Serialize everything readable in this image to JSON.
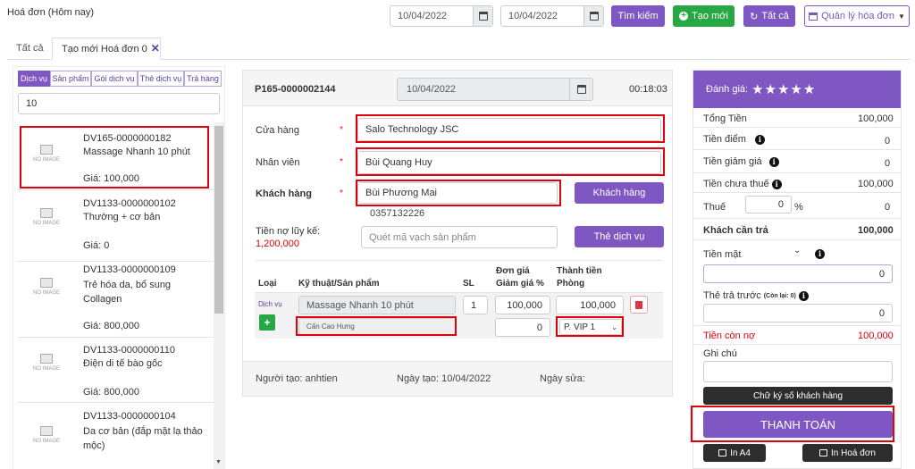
{
  "header": {
    "title": "Hoá đơn (Hôm nay)",
    "date_from": "10/04/2022",
    "date_to": "10/04/2022",
    "search_label": "Tìm kiếm",
    "new_label": "Tạo mới",
    "all_label": "Tất cả",
    "manage_label": "Quản lý hóa đơn"
  },
  "tabs": [
    {
      "label": "Tất cả"
    },
    {
      "label": "Tạo mới Hoá đơn 0"
    }
  ],
  "left": {
    "filters": [
      "Dịch vụ",
      "Sản phẩm",
      "Gói dịch vụ",
      "Thẻ dịch vụ",
      "Trả hàng"
    ],
    "search_value": "10",
    "noimage_label": "NO IMAGE",
    "items": [
      {
        "code": "DV165-0000000182",
        "name": "Massage Nhanh 10 phút",
        "price": "Giá: 100,000"
      },
      {
        "code": "DV1133-0000000102",
        "name": "Thường + cơ bản",
        "price": "Giá: 0"
      },
      {
        "code": "DV1133-0000000109",
        "name": "Trẻ hóa da, bổ sung Collagen",
        "price": "Giá: 800,000"
      },
      {
        "code": "DV1133-0000000110",
        "name": "Điện di tế bào gốc",
        "price": "Giá: 800,000"
      },
      {
        "code": "DV1133-0000000104",
        "name": "Da cơ bản (đắp mặt lạ thảo mộc)",
        "price": ""
      }
    ]
  },
  "center": {
    "invoice_code": "P165-0000002144",
    "date": "10/04/2022",
    "time": "00:18:03",
    "store_label": "Cửa hàng",
    "store_value": "Salo Technology JSC",
    "staff_label": "Nhân viên",
    "staff_value": "Bùi Quang Huy",
    "customer_label": "Khách hàng",
    "customer_value": "Bùi Phương Mai",
    "customer_phone": "0357132226",
    "customer_button": "Khách hàng",
    "debt_label": "Tiền nợ lũy kế:",
    "debt_value": "1,200,000",
    "barcode_placeholder": "Quét mã vạch sản phẩm",
    "service_card_button": "Thẻ dịch vụ",
    "required_mark": "*",
    "table": {
      "col_type": "Loại",
      "col_product": "Kỹ thuật/Sản phẩm",
      "col_qty": "SL",
      "col_price_1": "Đơn giá",
      "col_price_2": "Giảm giá %",
      "col_total_1": "Thành tiền",
      "col_total_2": "Phòng",
      "row": {
        "type": "Dịch vụ",
        "product": "Massage Nhanh 10 phút",
        "qty": "1",
        "price": "100,000",
        "total": "100,000",
        "technician": "Cấn Cao Hưng",
        "discount": "0",
        "room": "P. VIP 1"
      }
    },
    "footer": {
      "creator": "Người tạo: anhtien",
      "created": "Ngày tạo: 10/04/2022",
      "edited": "Ngày sửa:"
    }
  },
  "right": {
    "rating_label": "Đánh giá:",
    "rating_value": 5,
    "stars": "★★★★★",
    "rows": [
      {
        "label": "Tổng Tiền",
        "value": "100,000"
      },
      {
        "label": "Tiền điểm",
        "value": "0"
      },
      {
        "label": "Tiền giảm giá",
        "value": "0"
      },
      {
        "label": "Tiền chưa thuế",
        "value": "100,000"
      }
    ],
    "tax_label": "Thuế",
    "tax_input": "0",
    "tax_percent": "%",
    "tax_value": "0",
    "pay_label": "Khách cần trả",
    "pay_value": "100,000",
    "cash_label": "Tiền mặt",
    "cash_value": "0",
    "prepaid_label": "Thẻ trả trước",
    "prepaid_note": "(Còn lại: 0)",
    "prepaid_value": "0",
    "remaining_label": "Tiền còn nợ",
    "remaining_value": "100,000",
    "note_label": "Ghi chú",
    "signature_button": "Chữ ký số khách hàng",
    "pay_button": "THANH TOÁN",
    "print_a4": "In A4",
    "print_invoice": "In Hoá đơn"
  },
  "colors": {
    "accent": "#7e57c2",
    "success": "#28a745",
    "danger": "#e0000d",
    "dark": "#2d2d2d"
  }
}
